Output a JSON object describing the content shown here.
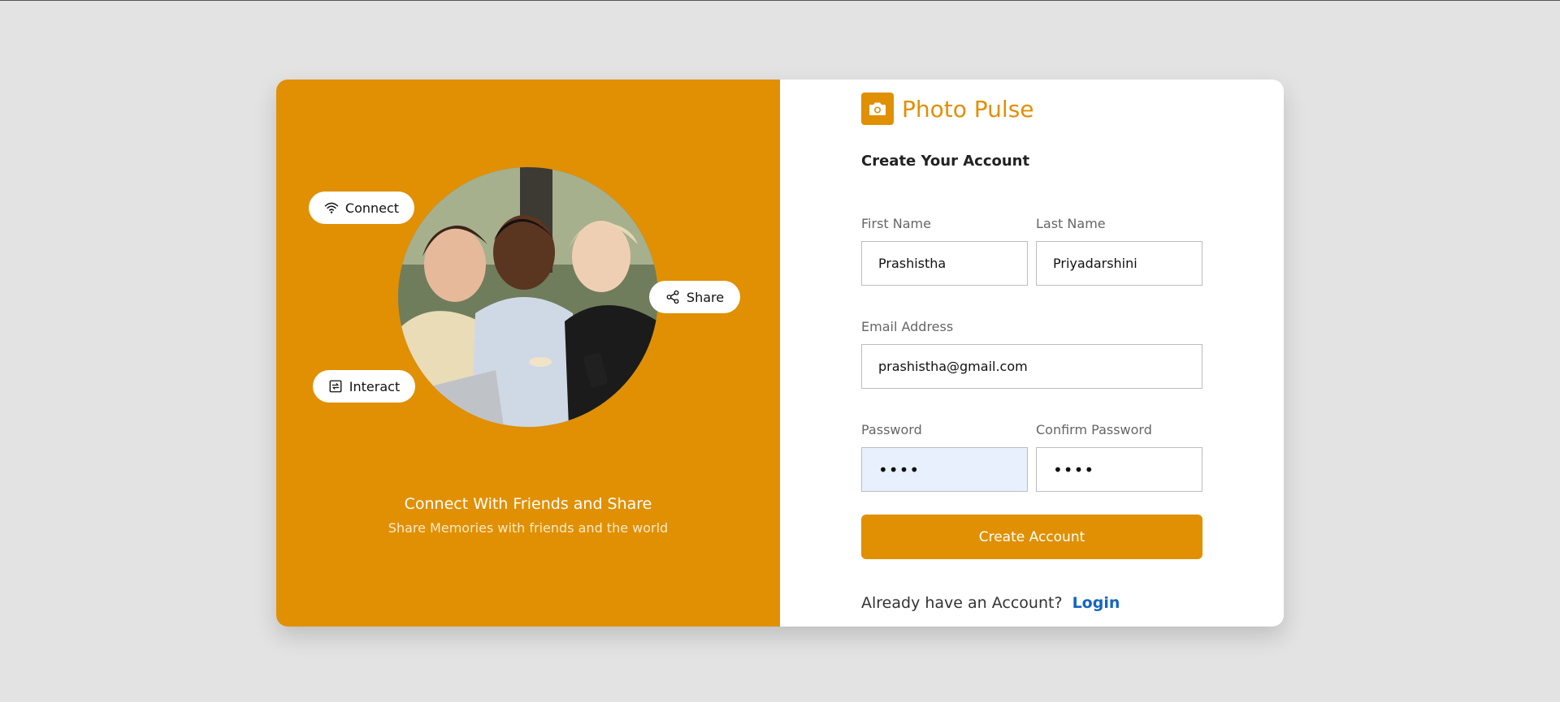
{
  "colors": {
    "accent": "#e09002",
    "link": "#1565c0",
    "page_background": "#e3e3e3"
  },
  "hero": {
    "image_alt": "Three friends looking at a smartphone together",
    "pills": {
      "connect": {
        "label": "Connect",
        "icon": "wifi-icon"
      },
      "share": {
        "label": "Share",
        "icon": "share-icon"
      },
      "interact": {
        "label": "Interact",
        "icon": "interact-icon"
      }
    },
    "title": "Connect With Friends and Share",
    "subtitle": "Share Memories with friends and the world"
  },
  "brand": {
    "name": "Photo Pulse",
    "icon": "camera-icon"
  },
  "form": {
    "heading": "Create Your Account",
    "first_name": {
      "label": "First Name",
      "value": "Prashistha"
    },
    "last_name": {
      "label": "Last Name",
      "value": "Priyadarshini"
    },
    "email": {
      "label": "Email Address",
      "value": "prashistha@gmail.com"
    },
    "password": {
      "label": "Password",
      "value": "••••"
    },
    "confirm_password": {
      "label": "Confirm Password",
      "value": "••••"
    },
    "submit_label": "Create Account",
    "footer_text": "Already have an Account?",
    "login_label": "Login"
  }
}
